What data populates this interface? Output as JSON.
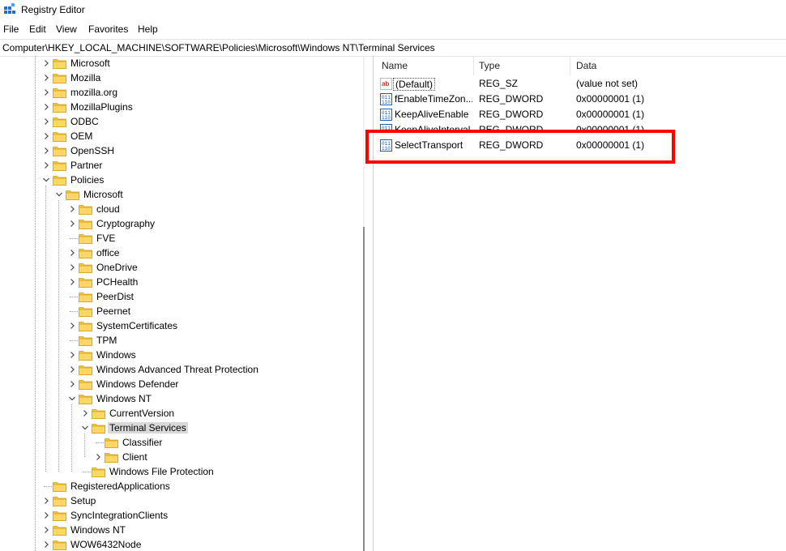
{
  "window": {
    "title": "Registry Editor",
    "icon": "registry-editor-icon"
  },
  "menu": [
    "File",
    "Edit",
    "View",
    "Favorites",
    "Help"
  ],
  "address": "Computer\\HKEY_LOCAL_MACHINE\\SOFTWARE\\Policies\\Microsoft\\Windows NT\\Terminal Services",
  "tree": [
    {
      "label": "Microsoft",
      "level": 0,
      "chevron": "collapsed"
    },
    {
      "label": "Mozilla",
      "level": 0,
      "chevron": "collapsed"
    },
    {
      "label": "mozilla.org",
      "level": 0,
      "chevron": "collapsed"
    },
    {
      "label": "MozillaPlugins",
      "level": 0,
      "chevron": "collapsed"
    },
    {
      "label": "ODBC",
      "level": 0,
      "chevron": "collapsed"
    },
    {
      "label": "OEM",
      "level": 0,
      "chevron": "collapsed"
    },
    {
      "label": "OpenSSH",
      "level": 0,
      "chevron": "collapsed"
    },
    {
      "label": "Partner",
      "level": 0,
      "chevron": "collapsed"
    },
    {
      "label": "Policies",
      "level": 0,
      "chevron": "expanded"
    },
    {
      "label": "Microsoft",
      "level": 1,
      "chevron": "expanded"
    },
    {
      "label": "cloud",
      "level": 2,
      "chevron": "collapsed"
    },
    {
      "label": "Cryptography",
      "level": 2,
      "chevron": "collapsed"
    },
    {
      "label": "FVE",
      "level": 2,
      "chevron": "none"
    },
    {
      "label": "office",
      "level": 2,
      "chevron": "collapsed"
    },
    {
      "label": "OneDrive",
      "level": 2,
      "chevron": "collapsed"
    },
    {
      "label": "PCHealth",
      "level": 2,
      "chevron": "collapsed"
    },
    {
      "label": "PeerDist",
      "level": 2,
      "chevron": "none"
    },
    {
      "label": "Peernet",
      "level": 2,
      "chevron": "none"
    },
    {
      "label": "SystemCertificates",
      "level": 2,
      "chevron": "collapsed"
    },
    {
      "label": "TPM",
      "level": 2,
      "chevron": "none"
    },
    {
      "label": "Windows",
      "level": 2,
      "chevron": "collapsed"
    },
    {
      "label": "Windows Advanced Threat Protection",
      "level": 2,
      "chevron": "collapsed"
    },
    {
      "label": "Windows Defender",
      "level": 2,
      "chevron": "collapsed"
    },
    {
      "label": "Windows NT",
      "level": 2,
      "chevron": "expanded"
    },
    {
      "label": "CurrentVersion",
      "level": 3,
      "chevron": "collapsed"
    },
    {
      "label": "Terminal Services",
      "level": 3,
      "chevron": "expanded",
      "selected": true
    },
    {
      "label": "Classifier",
      "level": 4,
      "chevron": "none"
    },
    {
      "label": "Client",
      "level": 4,
      "chevron": "collapsed"
    },
    {
      "label": "Windows File Protection",
      "level": 3,
      "chevron": "none"
    },
    {
      "label": "RegisteredApplications",
      "level": 0,
      "chevron": "none"
    },
    {
      "label": "Setup",
      "level": 0,
      "chevron": "collapsed"
    },
    {
      "label": "SyncIntegrationClients",
      "level": 0,
      "chevron": "collapsed"
    },
    {
      "label": "Windows NT",
      "level": 0,
      "chevron": "collapsed"
    },
    {
      "label": "WOW6432Node",
      "level": 0,
      "chevron": "collapsed"
    }
  ],
  "columns": {
    "name": "Name",
    "type": "Type",
    "data": "Data"
  },
  "values": [
    {
      "name": "(Default)",
      "type": "REG_SZ",
      "data": "(value not set)",
      "icon": "string-value-icon",
      "focused": true
    },
    {
      "name": "fEnableTimeZon...",
      "type": "REG_DWORD",
      "data": "0x00000001 (1)",
      "icon": "binary-value-icon"
    },
    {
      "name": "KeepAliveEnable",
      "type": "REG_DWORD",
      "data": "0x00000001 (1)",
      "icon": "binary-value-icon"
    },
    {
      "name": "KeepAliveInterval",
      "type": "REG_DWORD",
      "data": "0x00000001 (1)",
      "icon": "binary-value-icon"
    },
    {
      "name": "SelectTransport",
      "type": "REG_DWORD",
      "data": "0x00000001 (1)",
      "icon": "binary-value-icon"
    }
  ],
  "colors": {
    "highlight_box": "#ff0000",
    "folder": "#f4c542",
    "selected_bg": "#d9d9d9"
  }
}
